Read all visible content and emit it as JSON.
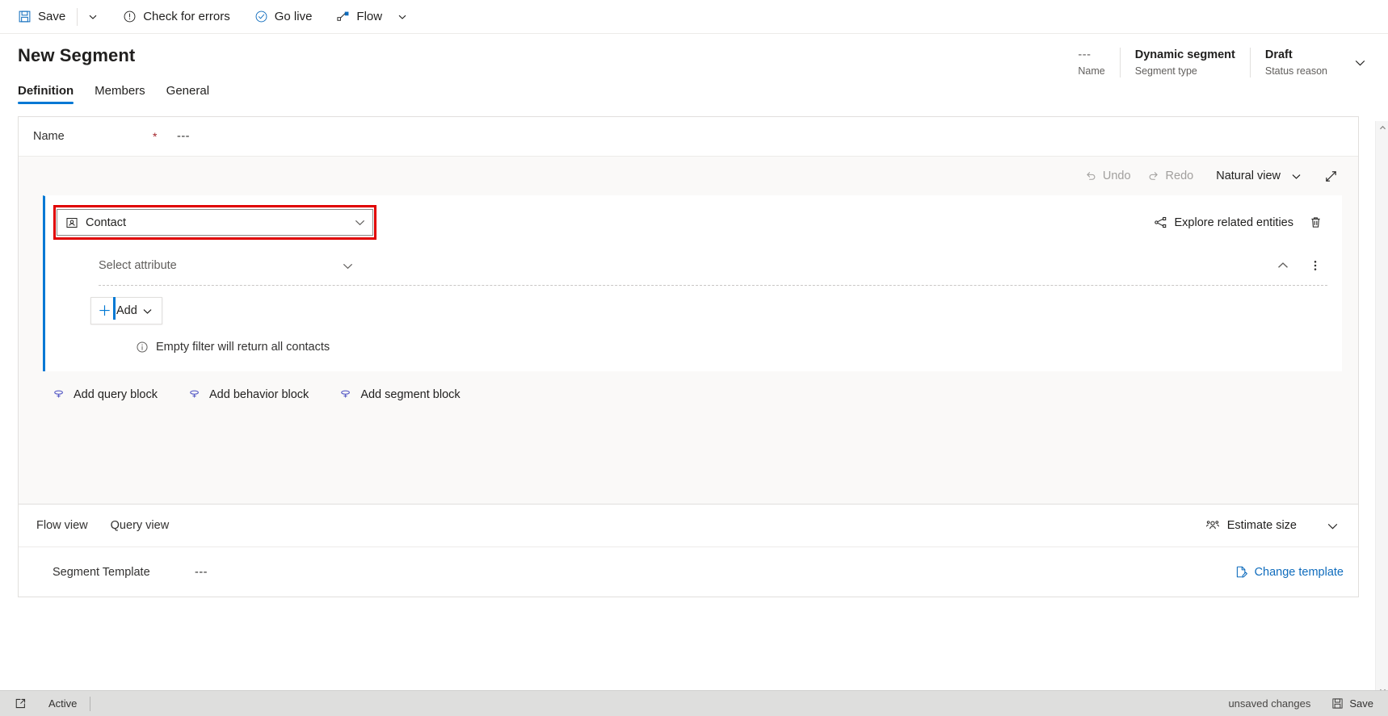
{
  "commandbar": {
    "save_label": "Save",
    "save_icon": "save-icon",
    "save_caret_icon": "chevron-down-icon",
    "check_errors_label": "Check for errors",
    "check_errors_icon": "exclamation-circle-icon",
    "go_live_label": "Go live",
    "go_live_icon": "check-circle-icon",
    "flow_label": "Flow",
    "flow_icon": "flow-icon",
    "flow_caret_icon": "chevron-down-icon"
  },
  "header": {
    "title": "New Segment",
    "fields": [
      {
        "value": "---",
        "label": "Name"
      },
      {
        "value": "Dynamic segment",
        "label": "Segment type"
      },
      {
        "value": "Draft",
        "label": "Status reason"
      }
    ],
    "expand_icon": "chevron-down-icon"
  },
  "tabs": [
    {
      "label": "Definition",
      "active": true
    },
    {
      "label": "Members",
      "active": false
    },
    {
      "label": "General",
      "active": false
    }
  ],
  "name_row": {
    "label": "Name",
    "required_mark": "*",
    "value": "---"
  },
  "canvas_toolbar": {
    "undo_label": "Undo",
    "undo_icon": "undo-icon",
    "redo_label": "Redo",
    "redo_icon": "redo-icon",
    "view_label": "Natural view",
    "view_caret_icon": "chevron-down-icon",
    "expand_icon": "expand-diagonal-icon"
  },
  "query_block": {
    "entity": {
      "value": "Contact",
      "entity_icon": "contact-entity-icon",
      "caret_icon": "chevron-down-icon",
      "highlight_color": "#e00000"
    },
    "explore_label": "Explore related entities",
    "explore_icon": "share-nodes-icon",
    "delete_icon": "trash-icon",
    "attribute": {
      "placeholder": "Select attribute",
      "caret_icon": "chevron-down-icon"
    },
    "collapse_icon": "chevron-up-icon",
    "more_icon": "more-vertical-icon",
    "add_label": "Add",
    "add_icon": "plus-icon",
    "add_caret_icon": "chevron-down-icon",
    "hint_text": "Empty filter will return all contacts",
    "hint_icon": "info-circle-icon"
  },
  "block_links": [
    {
      "label": "Add query block",
      "icon": "add-block-icon"
    },
    {
      "label": "Add behavior block",
      "icon": "add-block-icon"
    },
    {
      "label": "Add segment block",
      "icon": "add-block-icon"
    }
  ],
  "bottom_panel": {
    "views": [
      {
        "label": "Flow view"
      },
      {
        "label": "Query view"
      }
    ],
    "estimate_label": "Estimate size",
    "estimate_icon": "people-icon",
    "estimate_caret_icon": "chevron-down-icon",
    "template_label": "Segment Template",
    "template_value": "---",
    "change_template_label": "Change template",
    "change_template_icon": "edit-page-icon"
  },
  "statusbar": {
    "popout_icon": "popout-icon",
    "state_label": "Active",
    "unsaved_label": "unsaved changes",
    "save_label": "Save",
    "save_icon": "save-icon"
  },
  "colors": {
    "accent": "#0078d4",
    "link": "#0f6cbd",
    "highlight": "#e00000",
    "canvas_bg": "#faf9f8",
    "status_bg": "#dededd"
  }
}
